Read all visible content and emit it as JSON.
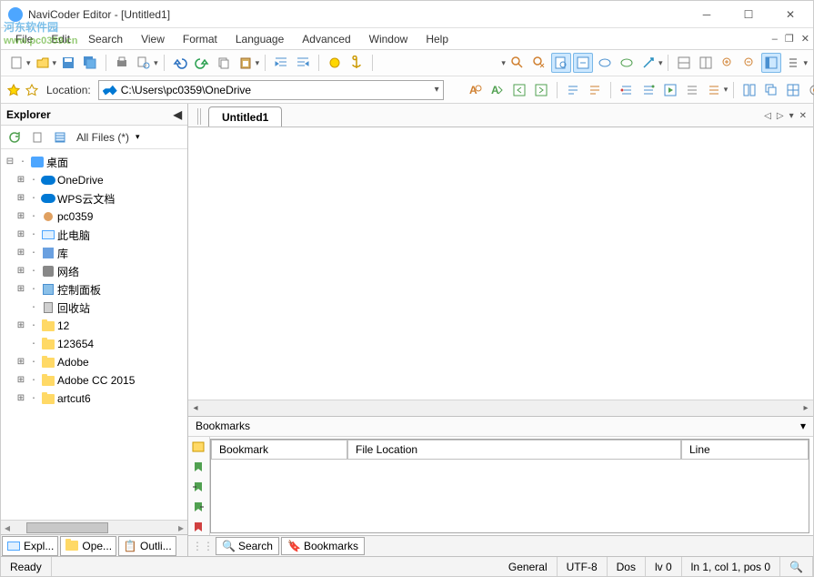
{
  "window": {
    "title": "NaviCoder Editor - [Untitled1]"
  },
  "watermark": {
    "main": "河东软件园",
    "sub": "www.pc0359.cn"
  },
  "menu": {
    "items": [
      "File",
      "Edit",
      "Search",
      "View",
      "Format",
      "Language",
      "Advanced",
      "Window",
      "Help"
    ]
  },
  "location": {
    "label": "Location:",
    "path": "C:\\Users\\pc0359\\OneDrive"
  },
  "explorer": {
    "title": "Explorer",
    "filter": "All Files (*)",
    "root": "桌面",
    "nodes": [
      {
        "label": "OneDrive",
        "icon": "cloud",
        "tw": "⊞"
      },
      {
        "label": "WPS云文档",
        "icon": "cloud",
        "tw": "⊞"
      },
      {
        "label": "pc0359",
        "icon": "user",
        "tw": "⊞"
      },
      {
        "label": "此电脑",
        "icon": "pc",
        "tw": "⊞"
      },
      {
        "label": "库",
        "icon": "lib",
        "tw": "⊞"
      },
      {
        "label": "网络",
        "icon": "net",
        "tw": "⊞"
      },
      {
        "label": "控制面板",
        "icon": "panel",
        "tw": "⊞"
      },
      {
        "label": "回收站",
        "icon": "bin",
        "tw": " "
      },
      {
        "label": "12",
        "icon": "folder",
        "tw": "⊞"
      },
      {
        "label": "123654",
        "icon": "folder",
        "tw": " "
      },
      {
        "label": "Adobe",
        "icon": "folder",
        "tw": "⊞"
      },
      {
        "label": "Adobe CC 2015",
        "icon": "folder",
        "tw": "⊞"
      },
      {
        "label": "artcut6",
        "icon": "folder",
        "tw": "⊞"
      }
    ],
    "tabs": [
      "Expl...",
      "Ope...",
      "Outli..."
    ]
  },
  "editor": {
    "tab": "Untitled1"
  },
  "bookmarks": {
    "title": "Bookmarks",
    "columns": [
      "Bookmark",
      "File Location",
      "Line"
    ],
    "bottom_tabs": [
      "Search",
      "Bookmarks"
    ]
  },
  "status": {
    "ready": "Ready",
    "general": "General",
    "encoding": "UTF-8",
    "eol": "Dos",
    "level": "lv 0",
    "pos": "ln 1, col 1, pos 0"
  }
}
